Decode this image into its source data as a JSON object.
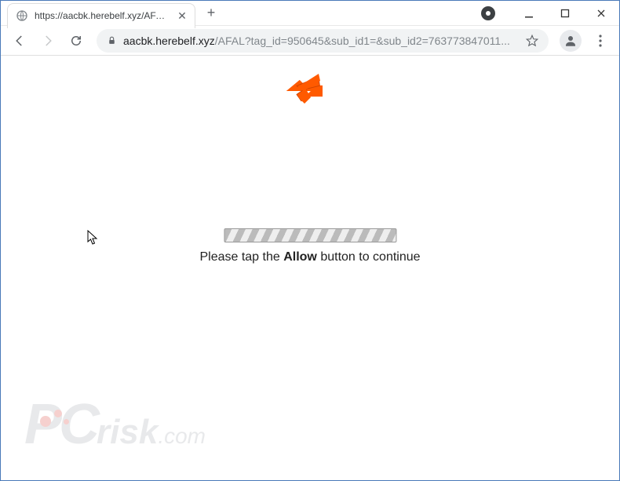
{
  "window": {
    "tab_title": "https://aacbk.herebelf.xyz/AFAL?t"
  },
  "address": {
    "domain": "aacbk.herebelf.xyz",
    "path": "/AFAL?tag_id=950645&sub_id1=&sub_id2=763773847011..."
  },
  "page": {
    "prompt_prefix": "Please tap the ",
    "prompt_emphasis": "Allow",
    "prompt_suffix": " button to continue"
  },
  "watermark": {
    "brand_prefix": "PC",
    "brand_mid": "risk",
    "brand_suffix": ".com"
  }
}
